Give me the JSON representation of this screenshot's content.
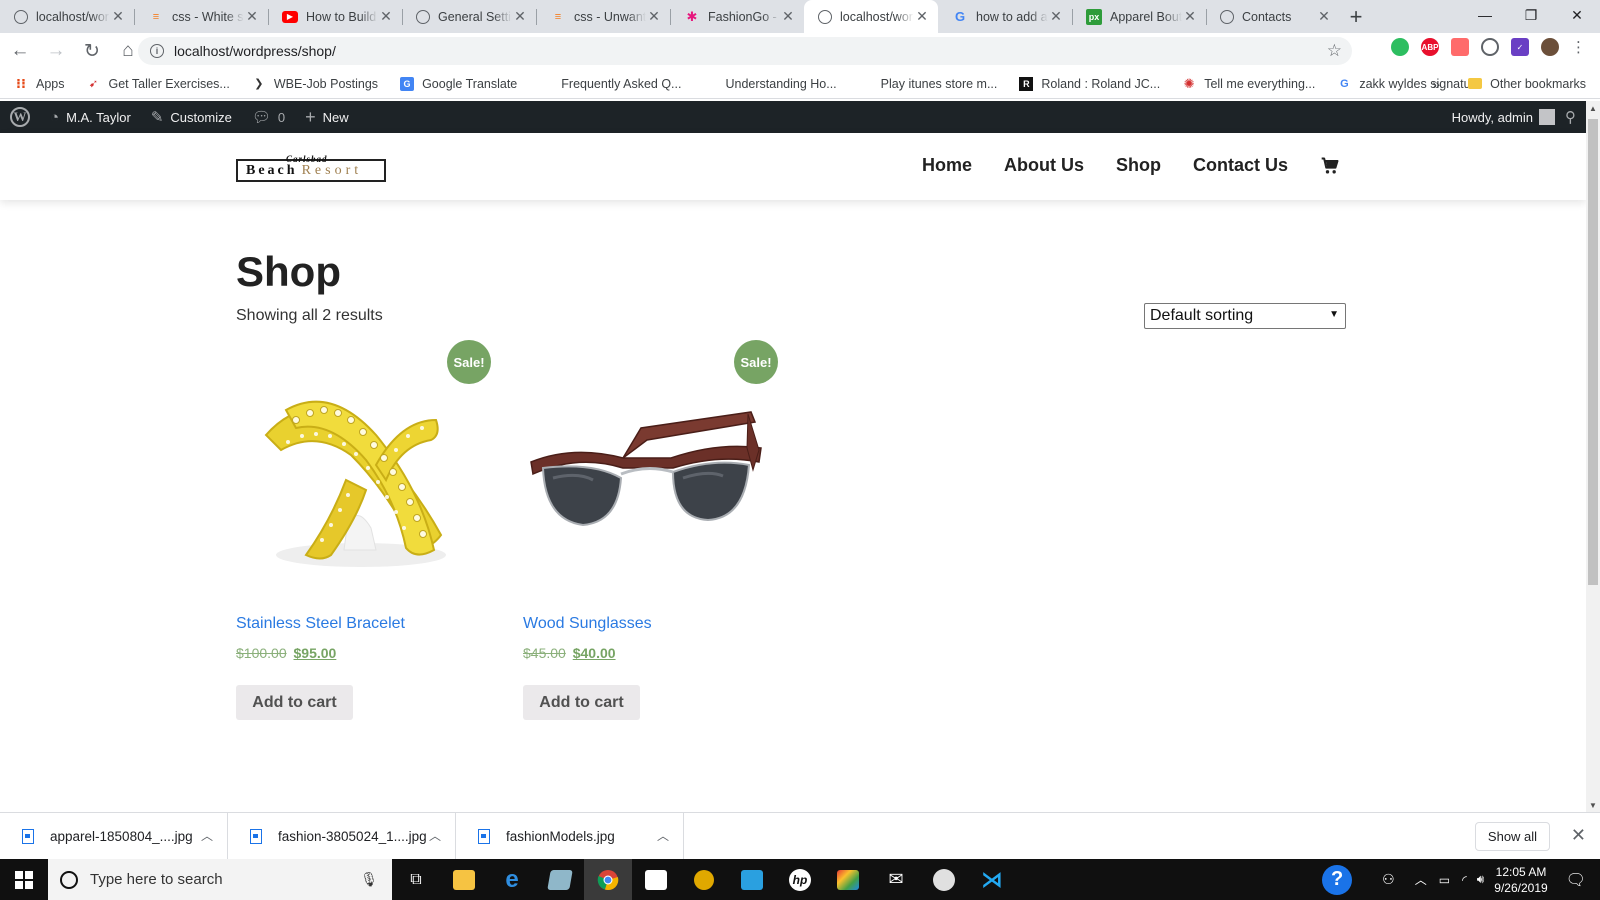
{
  "browser": {
    "tabs": [
      {
        "title": "localhost/wordpress",
        "favicon": "globe-icon",
        "active": false
      },
      {
        "title": "css - White space",
        "favicon": "stackoverflow-icon",
        "active": false
      },
      {
        "title": "How to Build",
        "favicon": "youtube-icon",
        "active": false
      },
      {
        "title": "General Settings",
        "favicon": "globe-icon",
        "active": false
      },
      {
        "title": "css - Unwanted",
        "favicon": "stackoverflow-icon",
        "active": false
      },
      {
        "title": "FashionGo - C",
        "favicon": "fashiongo-icon",
        "active": false
      },
      {
        "title": "localhost/wordpress",
        "favicon": "globe-icon",
        "active": true
      },
      {
        "title": "how to add a",
        "favicon": "google-icon",
        "active": false
      },
      {
        "title": "Apparel Boutique",
        "favicon": "px-icon",
        "active": false
      },
      {
        "title": "Contacts",
        "favicon": "globe-icon",
        "active": false
      }
    ],
    "url": "localhost/wordpress/shop/",
    "bookmarks": [
      {
        "label": "Apps",
        "icon": "apps-grid-icon"
      },
      {
        "label": "Get Taller Exercises...",
        "icon": "bookmark-icon"
      },
      {
        "label": "WBE-Job Postings",
        "icon": "bookmark-icon"
      },
      {
        "label": "Google Translate",
        "icon": "translate-icon"
      },
      {
        "label": "Frequently Asked Q...",
        "icon": "apple-icon"
      },
      {
        "label": "Understanding Ho...",
        "icon": "apple-icon"
      },
      {
        "label": "Play itunes store m...",
        "icon": "apple-icon"
      },
      {
        "label": "Roland : Roland JC...",
        "icon": "roland-icon"
      },
      {
        "label": "Tell me everything...",
        "icon": "bookmark-icon"
      },
      {
        "label": "zakk wyldes signatu...",
        "icon": "google-icon"
      }
    ],
    "bookmarks_more": "»",
    "other_bookmarks": "Other bookmarks"
  },
  "adminbar": {
    "site_name": "M.A. Taylor",
    "customize": "Customize",
    "comments_count": "0",
    "new_label": "New",
    "howdy": "Howdy, admin"
  },
  "site": {
    "logo": {
      "word1": "Beach",
      "word2": "Resort",
      "script": "Carlsbad"
    },
    "nav": [
      "Home",
      "About Us",
      "Shop",
      "Contact Us"
    ]
  },
  "shop": {
    "title": "Shop",
    "result_count": "Showing all 2 results",
    "sorting": "Default sorting",
    "products": [
      {
        "name": "Stainless Steel Bracelet",
        "old_price": "$100.00",
        "price": "$95.00",
        "badge": "Sale!",
        "button": "Add to cart"
      },
      {
        "name": "Wood Sunglasses",
        "old_price": "$45.00",
        "price": "$40.00",
        "badge": "Sale!",
        "button": "Add to cart"
      }
    ]
  },
  "downloads": {
    "items": [
      "apparel-1850804_....jpg",
      "fashion-3805024_1....jpg",
      "fashionModels.jpg"
    ],
    "show_all": "Show all"
  },
  "taskbar": {
    "search_placeholder": "Type here to search",
    "time": "12:05 AM",
    "date": "9/26/2019"
  },
  "colors": {
    "wp_adminbar": "#1d2327",
    "sale_badge": "#77a464",
    "product_link": "#2a7ae2",
    "button_bg": "#ebe9eb"
  }
}
